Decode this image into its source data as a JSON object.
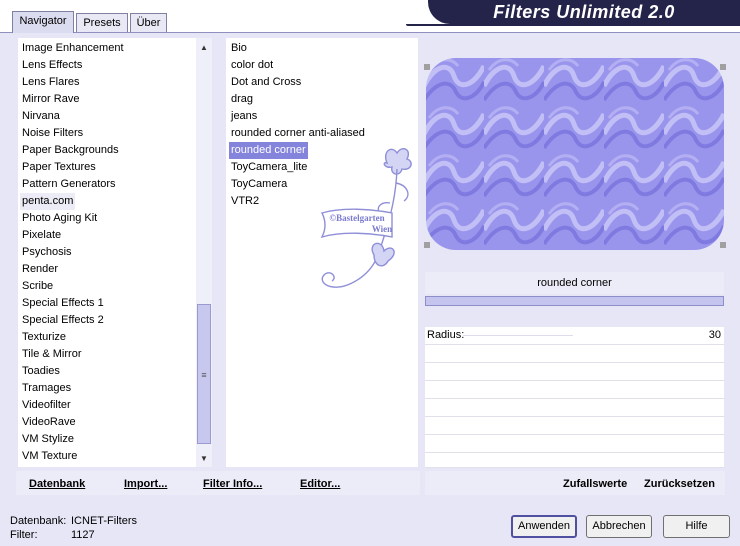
{
  "app_title": "Filters Unlimited 2.0",
  "tabs": [
    {
      "label": "Navigator",
      "active": true
    },
    {
      "label": "Presets",
      "active": false
    },
    {
      "label": "Über",
      "active": false
    }
  ],
  "categories": [
    "Image Enhancement",
    "Lens Effects",
    "Lens Flares",
    "Mirror Rave",
    "Nirvana",
    "Noise Filters",
    "Paper Backgrounds",
    "Paper Textures",
    "Pattern Generators",
    "penta.com",
    "Photo Aging Kit",
    "Pixelate",
    "Psychosis",
    "Render",
    "Scribe",
    "Special Effects 1",
    "Special Effects 2",
    "Texturize",
    "Tile & Mirror",
    "Toadies",
    "Tramages",
    "Videofilter",
    "VideoRave",
    "VM Stylize",
    "VM Texture"
  ],
  "current_category": "penta.com",
  "filters": [
    "Bio",
    "color dot",
    "Dot and Cross",
    "drag",
    "jeans",
    "rounded corner anti-aliased",
    "rounded corner",
    "ToyCamera_lite",
    "ToyCamera",
    "VTR2"
  ],
  "selected_filter": "rounded corner",
  "watermark": {
    "line1": "©Bastelgarten",
    "line2": "Wien"
  },
  "params_title": "rounded corner",
  "params": [
    {
      "label": "Radius:",
      "value": "30"
    }
  ],
  "menu": {
    "datenbank": "Datenbank",
    "import": "Import...",
    "filter_info": "Filter Info...",
    "editor": "Editor...",
    "random": "Zufallswerte",
    "reset": "Zurücksetzen"
  },
  "info": {
    "db_label": "Datenbank:",
    "db_value": "ICNET-Filters",
    "filter_label": "Filter:",
    "filter_value": "1127"
  },
  "buttons": {
    "apply": "Anwenden",
    "cancel": "Abbrechen",
    "help": "Hilfe"
  },
  "colors": {
    "accent": "#8484dc",
    "banner": "#24244a",
    "panel": "#e6e6f6",
    "preview": "#9a95ec"
  }
}
